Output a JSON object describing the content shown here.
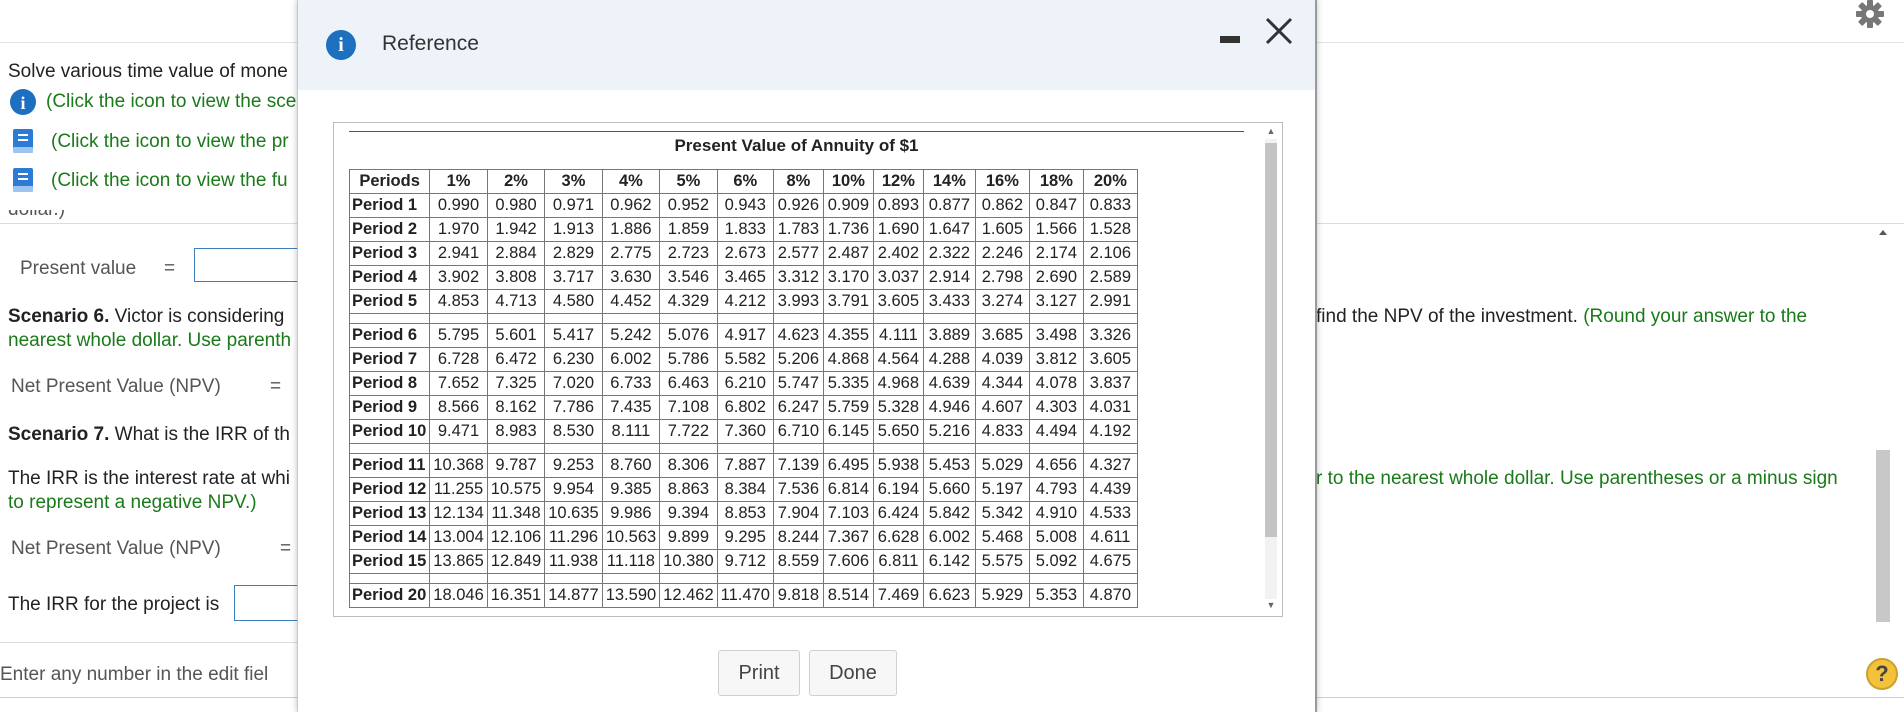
{
  "background": {
    "intro": "Solve various time value of mone",
    "link_scenarios": "(Click the icon to view the sce",
    "link_present": "(Click the icon to view the pr",
    "link_future": "(Click the icon to view the fu",
    "cut_text": "dollar.)",
    "present_value_label": "Present value",
    "equals": "=",
    "s6_bold": "Scenario 6.",
    "s6_text": " Victor is considering",
    "s6_line2": "nearest whole dollar. Use parenth",
    "s6_right": "find the NPV of the investment.",
    "s6_right_green": " (Round your answer to the",
    "npv_label": "Net Present Value (NPV)",
    "s7_bold": "Scenario 7.",
    "s7_text": " What is the IRR of th",
    "irr_line1": "The IRR is the interest rate at whi",
    "irr_line2": "to represent a negative NPV.)",
    "irr_right": "r to the nearest whole dollar. Use parentheses or a minus sign",
    "irr_label": "The IRR for the project is",
    "footer": "Enter any number in the edit fiel",
    "help": "?"
  },
  "modal": {
    "title": "Reference",
    "info_glyph": "i",
    "table_title": "Present Value of Annuity of $1",
    "print_label": "Print",
    "done_label": "Done"
  },
  "table": {
    "headers": [
      "Periods",
      "1%",
      "2%",
      "3%",
      "4%",
      "5%",
      "6%",
      "8%",
      "10%",
      "12%",
      "14%",
      "16%",
      "18%",
      "20%"
    ],
    "rows": [
      [
        "Period 1",
        "0.990",
        "0.980",
        "0.971",
        "0.962",
        "0.952",
        "0.943",
        "0.926",
        "0.909",
        "0.893",
        "0.877",
        "0.862",
        "0.847",
        "0.833"
      ],
      [
        "Period 2",
        "1.970",
        "1.942",
        "1.913",
        "1.886",
        "1.859",
        "1.833",
        "1.783",
        "1.736",
        "1.690",
        "1.647",
        "1.605",
        "1.566",
        "1.528"
      ],
      [
        "Period 3",
        "2.941",
        "2.884",
        "2.829",
        "2.775",
        "2.723",
        "2.673",
        "2.577",
        "2.487",
        "2.402",
        "2.322",
        "2.246",
        "2.174",
        "2.106"
      ],
      [
        "Period 4",
        "3.902",
        "3.808",
        "3.717",
        "3.630",
        "3.546",
        "3.465",
        "3.312",
        "3.170",
        "3.037",
        "2.914",
        "2.798",
        "2.690",
        "2.589"
      ],
      [
        "Period 5",
        "4.853",
        "4.713",
        "4.580",
        "4.452",
        "4.329",
        "4.212",
        "3.993",
        "3.791",
        "3.605",
        "3.433",
        "3.274",
        "3.127",
        "2.991"
      ],
      [
        "Period 6",
        "5.795",
        "5.601",
        "5.417",
        "5.242",
        "5.076",
        "4.917",
        "4.623",
        "4.355",
        "4.111",
        "3.889",
        "3.685",
        "3.498",
        "3.326"
      ],
      [
        "Period 7",
        "6.728",
        "6.472",
        "6.230",
        "6.002",
        "5.786",
        "5.582",
        "5.206",
        "4.868",
        "4.564",
        "4.288",
        "4.039",
        "3.812",
        "3.605"
      ],
      [
        "Period 8",
        "7.652",
        "7.325",
        "7.020",
        "6.733",
        "6.463",
        "6.210",
        "5.747",
        "5.335",
        "4.968",
        "4.639",
        "4.344",
        "4.078",
        "3.837"
      ],
      [
        "Period 9",
        "8.566",
        "8.162",
        "7.786",
        "7.435",
        "7.108",
        "6.802",
        "6.247",
        "5.759",
        "5.328",
        "4.946",
        "4.607",
        "4.303",
        "4.031"
      ],
      [
        "Period 10",
        "9.471",
        "8.983",
        "8.530",
        "8.111",
        "7.722",
        "7.360",
        "6.710",
        "6.145",
        "5.650",
        "5.216",
        "4.833",
        "4.494",
        "4.192"
      ],
      [
        "Period 11",
        "10.368",
        "9.787",
        "9.253",
        "8.760",
        "8.306",
        "7.887",
        "7.139",
        "6.495",
        "5.938",
        "5.453",
        "5.029",
        "4.656",
        "4.327"
      ],
      [
        "Period 12",
        "11.255",
        "10.575",
        "9.954",
        "9.385",
        "8.863",
        "8.384",
        "7.536",
        "6.814",
        "6.194",
        "5.660",
        "5.197",
        "4.793",
        "4.439"
      ],
      [
        "Period 13",
        "12.134",
        "11.348",
        "10.635",
        "9.986",
        "9.394",
        "8.853",
        "7.904",
        "7.103",
        "6.424",
        "5.842",
        "5.342",
        "4.910",
        "4.533"
      ],
      [
        "Period 14",
        "13.004",
        "12.106",
        "11.296",
        "10.563",
        "9.899",
        "9.295",
        "8.244",
        "7.367",
        "6.628",
        "6.002",
        "5.468",
        "5.008",
        "4.611"
      ],
      [
        "Period 15",
        "13.865",
        "12.849",
        "11.938",
        "11.118",
        "10.380",
        "9.712",
        "8.559",
        "7.606",
        "6.811",
        "6.142",
        "5.575",
        "5.092",
        "4.675"
      ],
      [
        "Period 20",
        "18.046",
        "16.351",
        "14.877",
        "13.590",
        "12.462",
        "11.470",
        "9.818",
        "8.514",
        "7.469",
        "6.623",
        "5.929",
        "5.353",
        "4.870"
      ]
    ],
    "groups": [
      5,
      10,
      15
    ]
  },
  "icons": {
    "gear": "gear-icon",
    "info": "info-icon",
    "book": "book-icon",
    "close": "close-icon",
    "minimize": "minimize-icon",
    "help": "help-icon"
  },
  "colors": {
    "accent": "#1d6fc0",
    "green_text": "#1a7a1a",
    "input_border": "#3f7fbf",
    "help": "#f3c23a"
  }
}
